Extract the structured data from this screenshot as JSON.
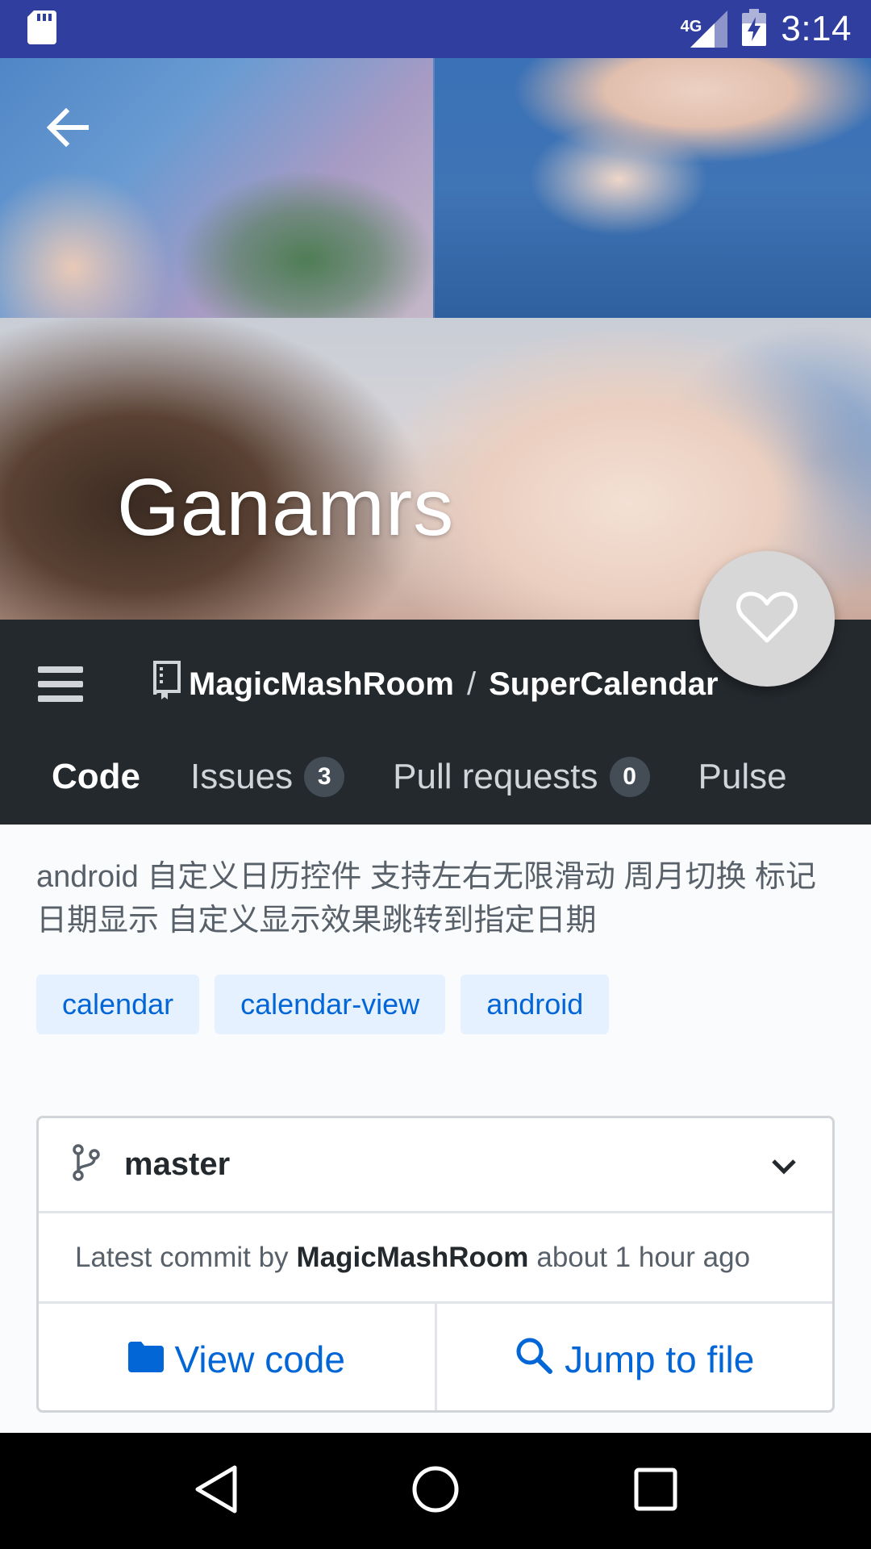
{
  "status_bar": {
    "time": "3:14",
    "network": "4G",
    "icons": [
      "sd-card-icon",
      "signal-icon",
      "battery-charging-icon"
    ]
  },
  "header": {
    "title": "Ganamrs",
    "back_icon": "arrow-back-icon",
    "favorite_icon": "heart-outline-icon"
  },
  "repo": {
    "owner": "MagicMashRoom",
    "separator": "/",
    "name": "SuperCalendar",
    "menu_icon": "hamburger-menu-icon",
    "repo_icon": "repo-book-icon"
  },
  "tabs": [
    {
      "label": "Code",
      "active": true,
      "count": null
    },
    {
      "label": "Issues",
      "active": false,
      "count": "3"
    },
    {
      "label": "Pull requests",
      "active": false,
      "count": "0"
    },
    {
      "label": "Pulse",
      "active": false,
      "count": null
    }
  ],
  "description": "android 自定义日历控件 支持左右无限滑动 周月切换 标记日期显示 自定义显示效果跳转到指定日期",
  "topics": [
    "calendar",
    "calendar-view",
    "android"
  ],
  "branch": {
    "name": "master",
    "icon": "git-branch-icon",
    "chevron": "chevron-down-icon"
  },
  "commit": {
    "prefix": "Latest commit by",
    "author": "MagicMashRoom",
    "time": "about 1 hour ago"
  },
  "actions": {
    "view_code": "View code",
    "jump_to_file": "Jump to file"
  },
  "colors": {
    "status_bar": "#303f9f",
    "repo_header": "#24292e",
    "link_blue": "#0366d6",
    "topic_bg": "#e6f1ff"
  },
  "nav_bar": [
    "back-triangle-icon",
    "home-circle-icon",
    "recents-square-icon"
  ]
}
